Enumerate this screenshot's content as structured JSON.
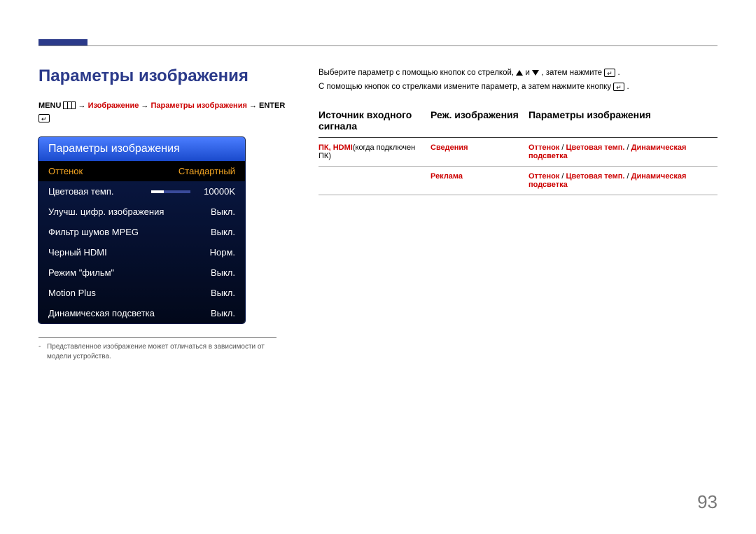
{
  "page": {
    "title": "Параметры изображения",
    "page_number": "93"
  },
  "breadcrumb": {
    "menu": "MENU",
    "arrow": " → ",
    "p1": "Изображение",
    "p2": "Параметры изображения",
    "enter": "ENTER"
  },
  "osd": {
    "title": "Параметры изображения",
    "rows": [
      {
        "label": "Оттенок",
        "value": "Стандартный",
        "selected": true
      },
      {
        "label": "Цветовая темп.",
        "value": "10000K",
        "slider": true
      },
      {
        "label": "Улучш. цифр. изображения",
        "value": "Выкл."
      },
      {
        "label": "Фильтр шумов MPEG",
        "value": "Выкл."
      },
      {
        "label": "Черный HDMI",
        "value": "Норм."
      },
      {
        "label": "Режим \"фильм\"",
        "value": "Выкл."
      },
      {
        "label": "Motion Plus",
        "value": "Выкл."
      },
      {
        "label": "Динамическая подсветка",
        "value": "Выкл."
      }
    ]
  },
  "footnote": "Представленное изображение может отличаться в зависимости от модели устройства.",
  "instructions": {
    "line1a": "Выберите параметр с помощью кнопок со стрелкой, ",
    "line1b": " и ",
    "line1c": ", затем нажмите ",
    "line1d": ".",
    "line2a": "С помощью кнопок со стрелками измените параметр, а затем нажмите кнопку ",
    "line2b": "."
  },
  "table": {
    "headers": {
      "c1": "Источник входного сигнала",
      "c2": "Реж. изображения",
      "c3": "Параметры изображения"
    },
    "rows": [
      {
        "c1_red": "ПК, HDMI",
        "c1_black": "(когда подключен ПК)",
        "c2": "Сведения",
        "c3_a": "Оттенок",
        "c3_sep": " / ",
        "c3_b": "Цветовая темп.",
        "c3_c": "Динамическая подсветка"
      },
      {
        "c1_red": "",
        "c1_black": "",
        "c2": "Реклама",
        "c3_a": "Оттенок",
        "c3_sep": " / ",
        "c3_b": "Цветовая темп.",
        "c3_c": "Динамическая подсветка"
      }
    ]
  }
}
